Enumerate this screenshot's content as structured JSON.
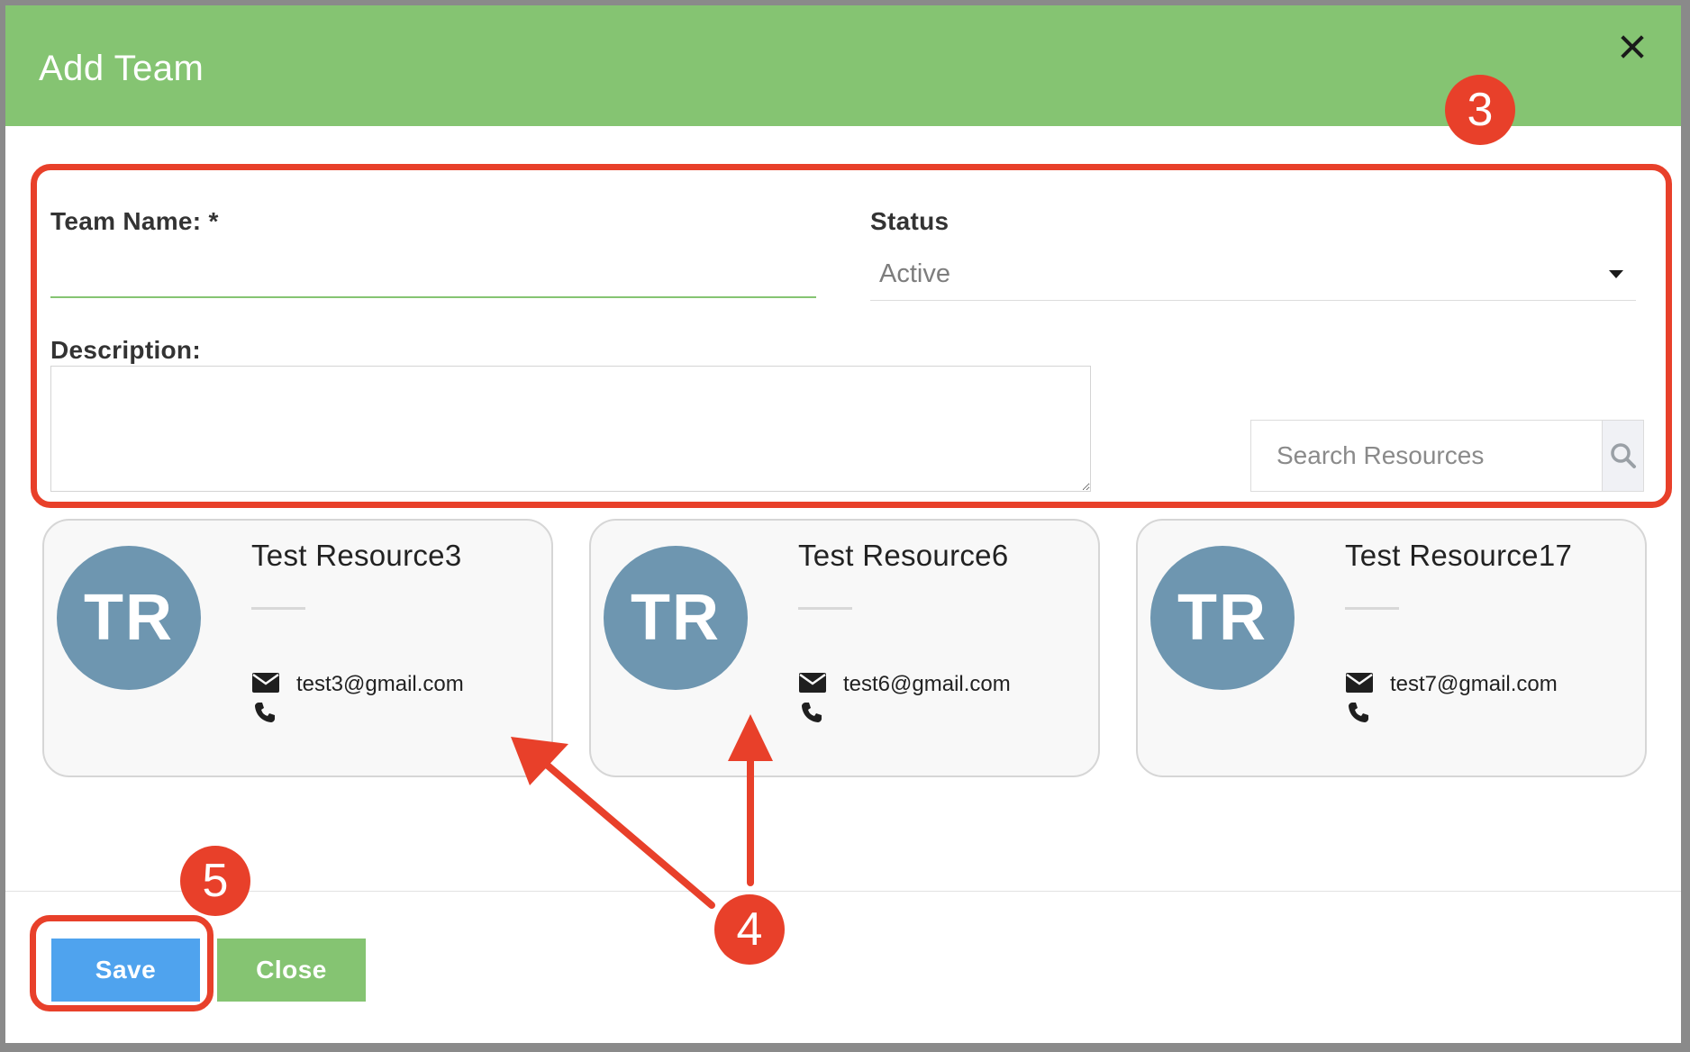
{
  "modal": {
    "title": "Add Team",
    "header_color": "#85c472"
  },
  "form": {
    "team_name_label": "Team Name: *",
    "team_name_value": "",
    "status_label": "Status",
    "status_value": "Active",
    "description_label": "Description:",
    "description_value": "",
    "search_placeholder": "Search Resources"
  },
  "resources": [
    {
      "initials": "TR",
      "name": "Test Resource3",
      "email": "test3@gmail.com",
      "phone": ""
    },
    {
      "initials": "TR",
      "name": "Test Resource6",
      "email": "test6@gmail.com",
      "phone": ""
    },
    {
      "initials": "TR",
      "name": "Test Resource17",
      "email": "test7@gmail.com",
      "phone": ""
    }
  ],
  "footer": {
    "save_label": "Save",
    "close_label": "Close"
  },
  "annotations": {
    "step_3": "3",
    "step_4": "4",
    "step_5": "5",
    "color": "#e8402a"
  },
  "icons": [
    "close-icon",
    "caret-down-icon",
    "search-icon",
    "envelope-icon",
    "phone-icon"
  ]
}
